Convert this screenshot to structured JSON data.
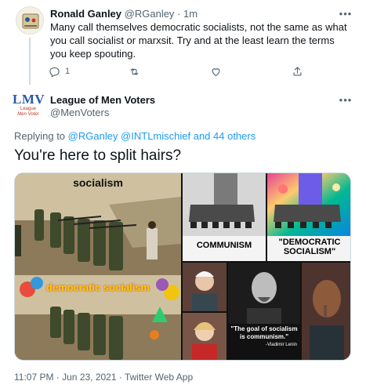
{
  "reply": {
    "name": "Ronald Ganley",
    "handle": "@RGanley",
    "time": "· 1m",
    "text": "Many call themselves democratic socialists, not the same as what you call socialist or marxsit. Try and at the least learn the terms you keep spouting.",
    "reply_count": "1"
  },
  "main": {
    "logo_text": "LMV",
    "logo_sub1": "League",
    "logo_sub2": "Men Voter",
    "name": "League of Men Voters",
    "handle": "@MenVoters",
    "replying_prefix": "Replying to",
    "replying_to": "@RGanley @INTLmischief and 44 others",
    "text": "You're here to split hairs?",
    "timestamp": "11:07 PM · Jun 23, 2021 · Twitter Web App"
  },
  "media": {
    "caption_socialism": "socialism",
    "caption_democratic": "democratic socialism",
    "caption_communism": "COMMUNISM",
    "caption_dem_soc_1": "\"DEMOCRATIC",
    "caption_dem_soc_2": "SOCIALISM\"",
    "quote_1": "\"The goal of socialism",
    "quote_2": "is communism.\"",
    "quote_author": "-Vladimir Lenin"
  },
  "icons": [
    "reply-icon",
    "retweet-icon",
    "like-icon",
    "share-icon",
    "more-icon"
  ],
  "colors": {
    "link": "#1d9bf0",
    "secondary": "#536471",
    "primary_text": "#0f1419"
  }
}
